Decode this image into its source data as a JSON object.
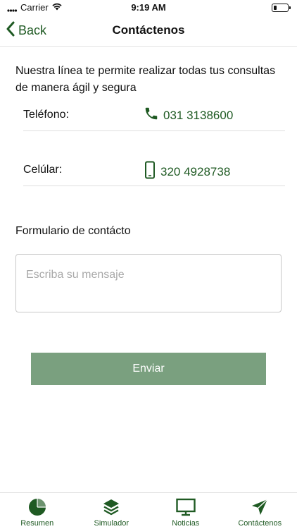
{
  "status_bar": {
    "carrier": "Carrier",
    "time": "9:19 AM",
    "battery_level": 0.2
  },
  "nav": {
    "back_label": "Back",
    "title": "Contáctenos"
  },
  "intro_text": "Nuestra línea te permite realizar todas tus consultas de manera ágil y segura",
  "contacts": [
    {
      "label": "Teléfono:",
      "value": "031 3138600",
      "icon": "phone-icon"
    },
    {
      "label": "Celúlar:",
      "value": "320 4928738",
      "icon": "mobile-phone-icon"
    }
  ],
  "form": {
    "label": "Formulario de contácto",
    "message_placeholder": "Escriba su mensaje",
    "message_value": "",
    "send_label": "Enviar"
  },
  "tab_bar": {
    "items": [
      {
        "label": "Resumen",
        "icon": "pie-chart-icon"
      },
      {
        "label": "Simulador",
        "icon": "layers-icon"
      },
      {
        "label": "Noticias",
        "icon": "monitor-icon"
      },
      {
        "label": "Contáctenos",
        "icon": "send-icon"
      }
    ]
  },
  "colors": {
    "accent": "#1f5a23",
    "button": "#7aa07f"
  }
}
